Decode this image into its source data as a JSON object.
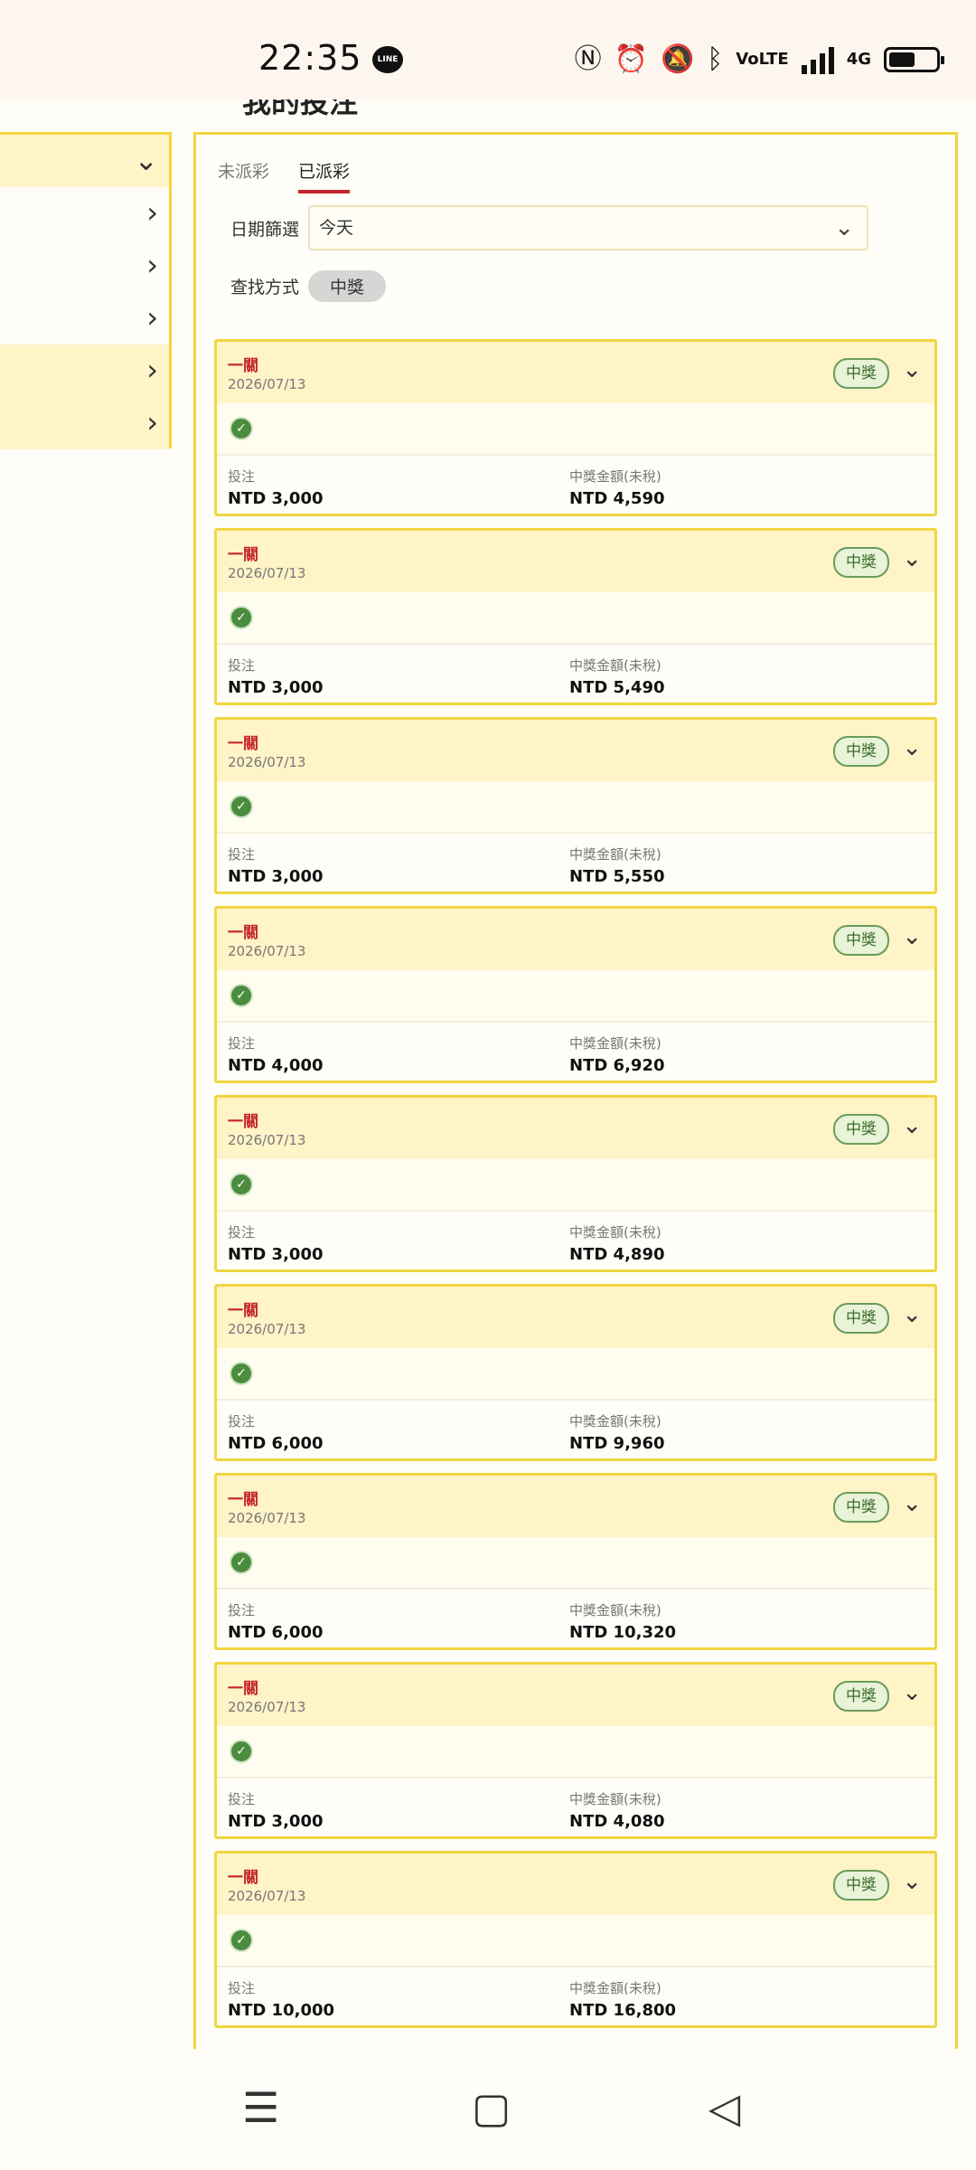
{
  "status_bar": {
    "time": "22:35",
    "line_label": "LINE",
    "icons": [
      "nfc-icon",
      "alarm-icon",
      "mute-icon",
      "bluetooth-icon",
      "volte-icon",
      "signal-icon",
      "4g-signal-icon",
      "battery-icon"
    ],
    "volte_text": "VoLTE",
    "net_text": "4G",
    "battery_level": 0.55
  },
  "header": {
    "title_peek": "我的投注"
  },
  "sidebar": {
    "items": [
      {
        "highlighted": true,
        "chevron": "⌄"
      },
      {
        "highlighted": false,
        "chevron": "›"
      },
      {
        "highlighted": false,
        "chevron": "›"
      },
      {
        "highlighted": false,
        "chevron": "›"
      },
      {
        "highlighted": true,
        "chevron": "›"
      },
      {
        "highlighted": true,
        "chevron": "›"
      }
    ]
  },
  "tabs": [
    {
      "label": "未派彩",
      "active": false
    },
    {
      "label": "已派彩",
      "active": true
    }
  ],
  "filter": {
    "date_label": "日期篩選",
    "date_value": "今天",
    "method_label": "查找方式",
    "method_value": "中獎"
  },
  "bets": [
    {
      "title": "一關",
      "date": "2026/07/13",
      "status": "中獎",
      "stake_label": "投注",
      "stake": "NTD 3,000",
      "payout_label": "中獎金額(未稅)",
      "payout": "NTD 4,590"
    },
    {
      "title": "一關",
      "date": "2026/07/13",
      "status": "中獎",
      "stake_label": "投注",
      "stake": "NTD 3,000",
      "payout_label": "中獎金額(未稅)",
      "payout": "NTD 5,490"
    },
    {
      "title": "一關",
      "date": "2026/07/13",
      "status": "中獎",
      "stake_label": "投注",
      "stake": "NTD 3,000",
      "payout_label": "中獎金額(未稅)",
      "payout": "NTD 5,550"
    },
    {
      "title": "一關",
      "date": "2026/07/13",
      "status": "中獎",
      "stake_label": "投注",
      "stake": "NTD 4,000",
      "payout_label": "中獎金額(未稅)",
      "payout": "NTD 6,920"
    },
    {
      "title": "一關",
      "date": "2026/07/13",
      "status": "中獎",
      "stake_label": "投注",
      "stake": "NTD 3,000",
      "payout_label": "中獎金額(未稅)",
      "payout": "NTD 4,890"
    },
    {
      "title": "一關",
      "date": "2026/07/13",
      "status": "中獎",
      "stake_label": "投注",
      "stake": "NTD 6,000",
      "payout_label": "中獎金額(未稅)",
      "payout": "NTD 9,960"
    },
    {
      "title": "一關",
      "date": "2026/07/13",
      "status": "中獎",
      "stake_label": "投注",
      "stake": "NTD 6,000",
      "payout_label": "中獎金額(未稅)",
      "payout": "NTD 10,320"
    },
    {
      "title": "一關",
      "date": "2026/07/13",
      "status": "中獎",
      "stake_label": "投注",
      "stake": "NTD 3,000",
      "payout_label": "中獎金額(未稅)",
      "payout": "NTD 4,080"
    },
    {
      "title": "一關",
      "date": "2026/07/13",
      "status": "中獎",
      "stake_label": "投注",
      "stake": "NTD 10,000",
      "payout_label": "中獎金額(未稅)",
      "payout": "NTD 16,800"
    }
  ],
  "nav_bar": {
    "menu_glyph": "☰",
    "home_glyph": "▢",
    "back_glyph": "◁"
  }
}
